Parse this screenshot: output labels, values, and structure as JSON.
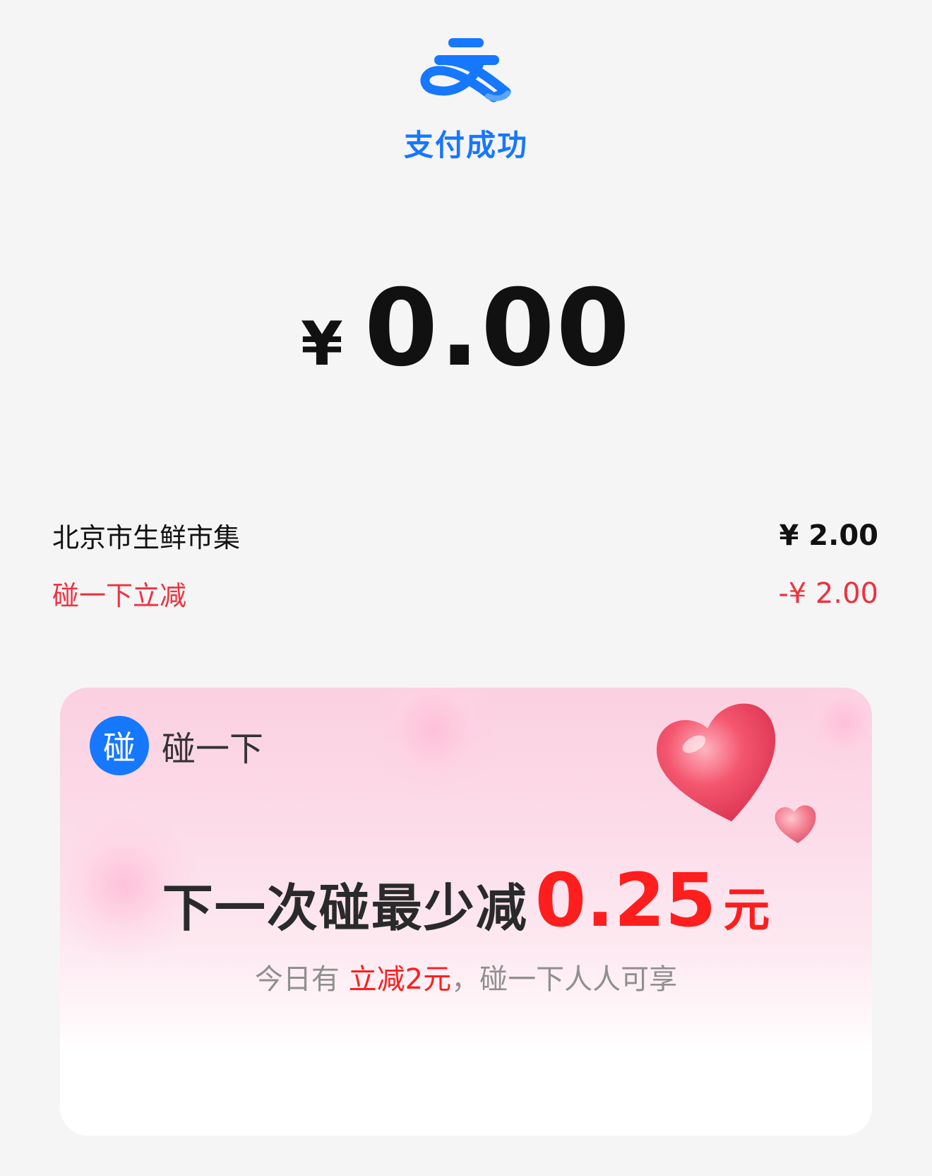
{
  "header": {
    "logo_icon": "alipay-logo-icon",
    "status": "支付成功",
    "brand_color": "#1677ff"
  },
  "amount": {
    "currency": "¥",
    "value": "0.00"
  },
  "order": {
    "merchant_name": "北京市生鲜市集",
    "merchant_price": "¥ 2.00",
    "discount_label": "碰一下立减",
    "discount_value": "-¥ 2.00",
    "discount_color": "#f0313f"
  },
  "promo": {
    "brand_badge": "碰",
    "brand_name": "碰一下",
    "headline_lead": "下一次碰最少减",
    "headline_amount": "0.25",
    "headline_unit": "元",
    "sub_prefix": "今日有 ",
    "sub_highlight": "立减2元",
    "sub_suffix": "，碰一下人人可享",
    "decor_icon": "hearts-icon",
    "highlight_color": "#ff1e1e"
  }
}
